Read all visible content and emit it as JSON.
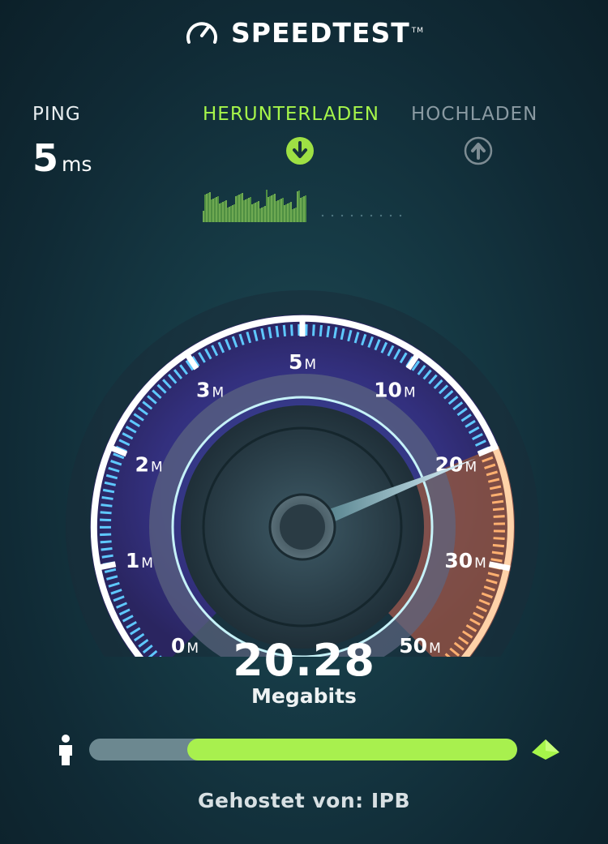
{
  "header": {
    "brand": "SPEEDTEST",
    "trademark": "TM",
    "icon": "speedometer-icon"
  },
  "ping": {
    "label": "PING",
    "value": "5",
    "unit": "ms"
  },
  "download": {
    "label": "HERUNTERLADEN",
    "icon": "download-arrow-icon",
    "color": "#a6f54a"
  },
  "upload": {
    "label": "HOCHLADEN",
    "icon": "upload-arrow-icon",
    "color": "#8a9aa2"
  },
  "gauge": {
    "ticks": [
      {
        "num": "0",
        "unit": "M"
      },
      {
        "num": "1",
        "unit": "M"
      },
      {
        "num": "2",
        "unit": "M"
      },
      {
        "num": "3",
        "unit": "M"
      },
      {
        "num": "5",
        "unit": "M"
      },
      {
        "num": "10",
        "unit": "M"
      },
      {
        "num": "20",
        "unit": "M"
      },
      {
        "num": "30",
        "unit": "M"
      },
      {
        "num": "50",
        "unit": "M"
      }
    ],
    "needle_value": 20.28
  },
  "result": {
    "value": "20.28",
    "unit": "Megabits"
  },
  "progress": {
    "start_fraction": 0.23,
    "end_fraction": 1.0,
    "fill_color": "#a8f04e",
    "track_color": "#6c8890"
  },
  "server": {
    "hosted_by": "Gehostet von: IPB"
  },
  "icons": {
    "user": "person-icon",
    "server": "server-icon"
  }
}
